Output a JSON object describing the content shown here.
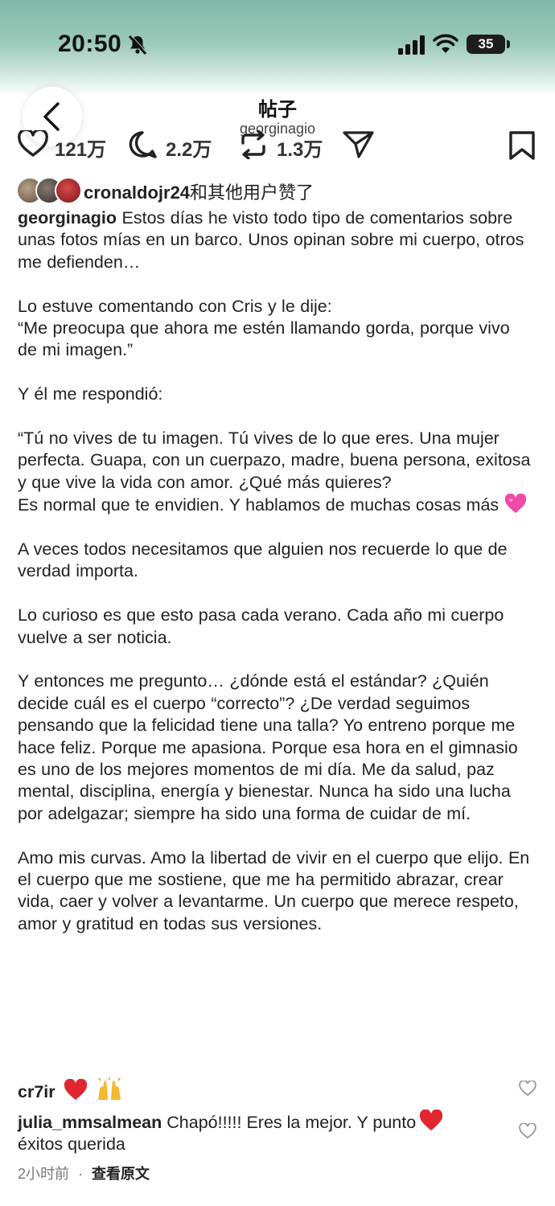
{
  "status_bar": {
    "time": "20:50",
    "battery": "35"
  },
  "header": {
    "title": "帖子",
    "username": "georginagio"
  },
  "actions": {
    "likes_count": "121万",
    "comments_count": "2.2万",
    "reposts_count": "1.3万"
  },
  "likes": {
    "username": "cronaldojr24",
    "suffix": "和其他用户赞了"
  },
  "caption": {
    "author": "georginagio",
    "first_line": "Estos días he visto todo tipo de comentarios sobre unas fotos mías en un barco. Unos opinan sobre mi cuerpo, otros me defienden…",
    "paragraphs": [
      "Lo estuve comentando con Cris y le dije:\n“Me preocupa que ahora me estén llamando gorda, porque vivo de mi imagen.”",
      "Y él me respondió:",
      "“Tú no vives de tu imagen. Tú vives de lo que eres. Una mujer perfecta. Guapa, con un cuerpazo, madre, buena persona, exitosa y que vive la vida con amor. ¿Qué más quieres?\nEs normal que te envidien. Y hablamos de muchas cosas más",
      " A veces todos necesitamos que alguien nos recuerde lo que de verdad importa.",
      "Lo curioso es que esto pasa cada verano. Cada año mi cuerpo vuelve a ser noticia.",
      "Y entonces me pregunto… ¿dónde está el estándar? ¿Quién decide cuál es el cuerpo “correcto”? ¿De verdad seguimos pensando que la felicidad tiene una talla?  Yo entreno porque me hace feliz. Porque me apasiona. Porque esa hora en el gimnasio es uno de los mejores momentos de mi día. Me da salud, paz mental, disciplina, energía y bienestar. Nunca ha sido una lucha por adelgazar; siempre ha sido una forma de cuidar de mí.",
      "Amo mis curvas. Amo la libertad de vivir en el cuerpo que elijo. En el cuerpo que me sostiene, que me ha permitido abrazar, crear vida, caer y volver a levantarme. Un cuerpo que merece respeto, amor y gratitud en todas sus versiones."
    ]
  },
  "comments": [
    {
      "user": "cr7ir",
      "text": ""
    },
    {
      "user": "julia_mmsalmean",
      "text": "Chapó!!!!! Eres la mejor. Y punto",
      "text_2": "éxitos querida"
    }
  ],
  "footer": {
    "time_ago": "2小时前",
    "separator": "·",
    "view_original": "查看原文"
  },
  "colors": {
    "header_gradient_top": "#7fb8a8",
    "text": "#222222",
    "heart_red": "#e0262f",
    "heart_pink": "#f04aa8"
  }
}
